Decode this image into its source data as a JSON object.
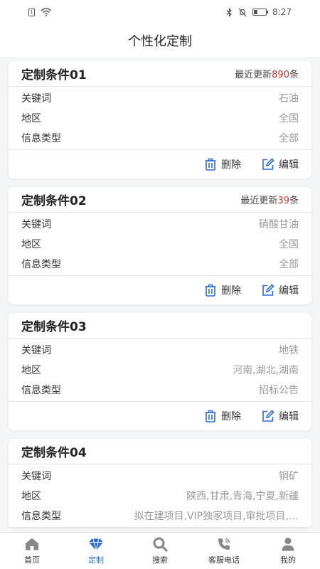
{
  "status": {
    "time": "8:27",
    "sim": "1"
  },
  "header": {
    "title": "个性化定制"
  },
  "actions": {
    "delete_label": "删除",
    "edit_label": "编辑"
  },
  "cards": [
    {
      "title": "定制条件01",
      "update_prefix": "最近更新",
      "update_count": "890",
      "update_suffix": "条",
      "rows": [
        {
          "label": "关键词",
          "value": "石油"
        },
        {
          "label": "地区",
          "value": "全国"
        },
        {
          "label": "信息类型",
          "value": "全部"
        }
      ]
    },
    {
      "title": "定制条件02",
      "update_prefix": "最近更新",
      "update_count": "39",
      "update_suffix": "条",
      "rows": [
        {
          "label": "关键词",
          "value": "硝酸甘油"
        },
        {
          "label": "地区",
          "value": "全国"
        },
        {
          "label": "信息类型",
          "value": "全部"
        }
      ]
    },
    {
      "title": "定制条件03",
      "rows": [
        {
          "label": "关键词",
          "value": "地铁"
        },
        {
          "label": "地区",
          "value": "河南,湖北,湖南"
        },
        {
          "label": "信息类型",
          "value": "招标公告"
        }
      ]
    },
    {
      "title": "定制条件04",
      "rows": [
        {
          "label": "关键词",
          "value": "铜矿"
        },
        {
          "label": "地区",
          "value": "陕西,甘肃,青海,宁夏,新疆"
        },
        {
          "label": "信息类型",
          "value": "拟在建项目,VIP独家项目,审批项目,…"
        }
      ]
    }
  ],
  "tabbar": {
    "items": [
      {
        "label": "首页",
        "icon": "home-icon"
      },
      {
        "label": "定制",
        "icon": "diamond-icon",
        "active": true
      },
      {
        "label": "搜索",
        "icon": "search-icon"
      },
      {
        "label": "客服电话",
        "icon": "phone-icon"
      },
      {
        "label": "我的",
        "icon": "user-icon"
      }
    ]
  },
  "colors": {
    "accent": "#2a6dd9",
    "highlight": "#c0392b"
  }
}
